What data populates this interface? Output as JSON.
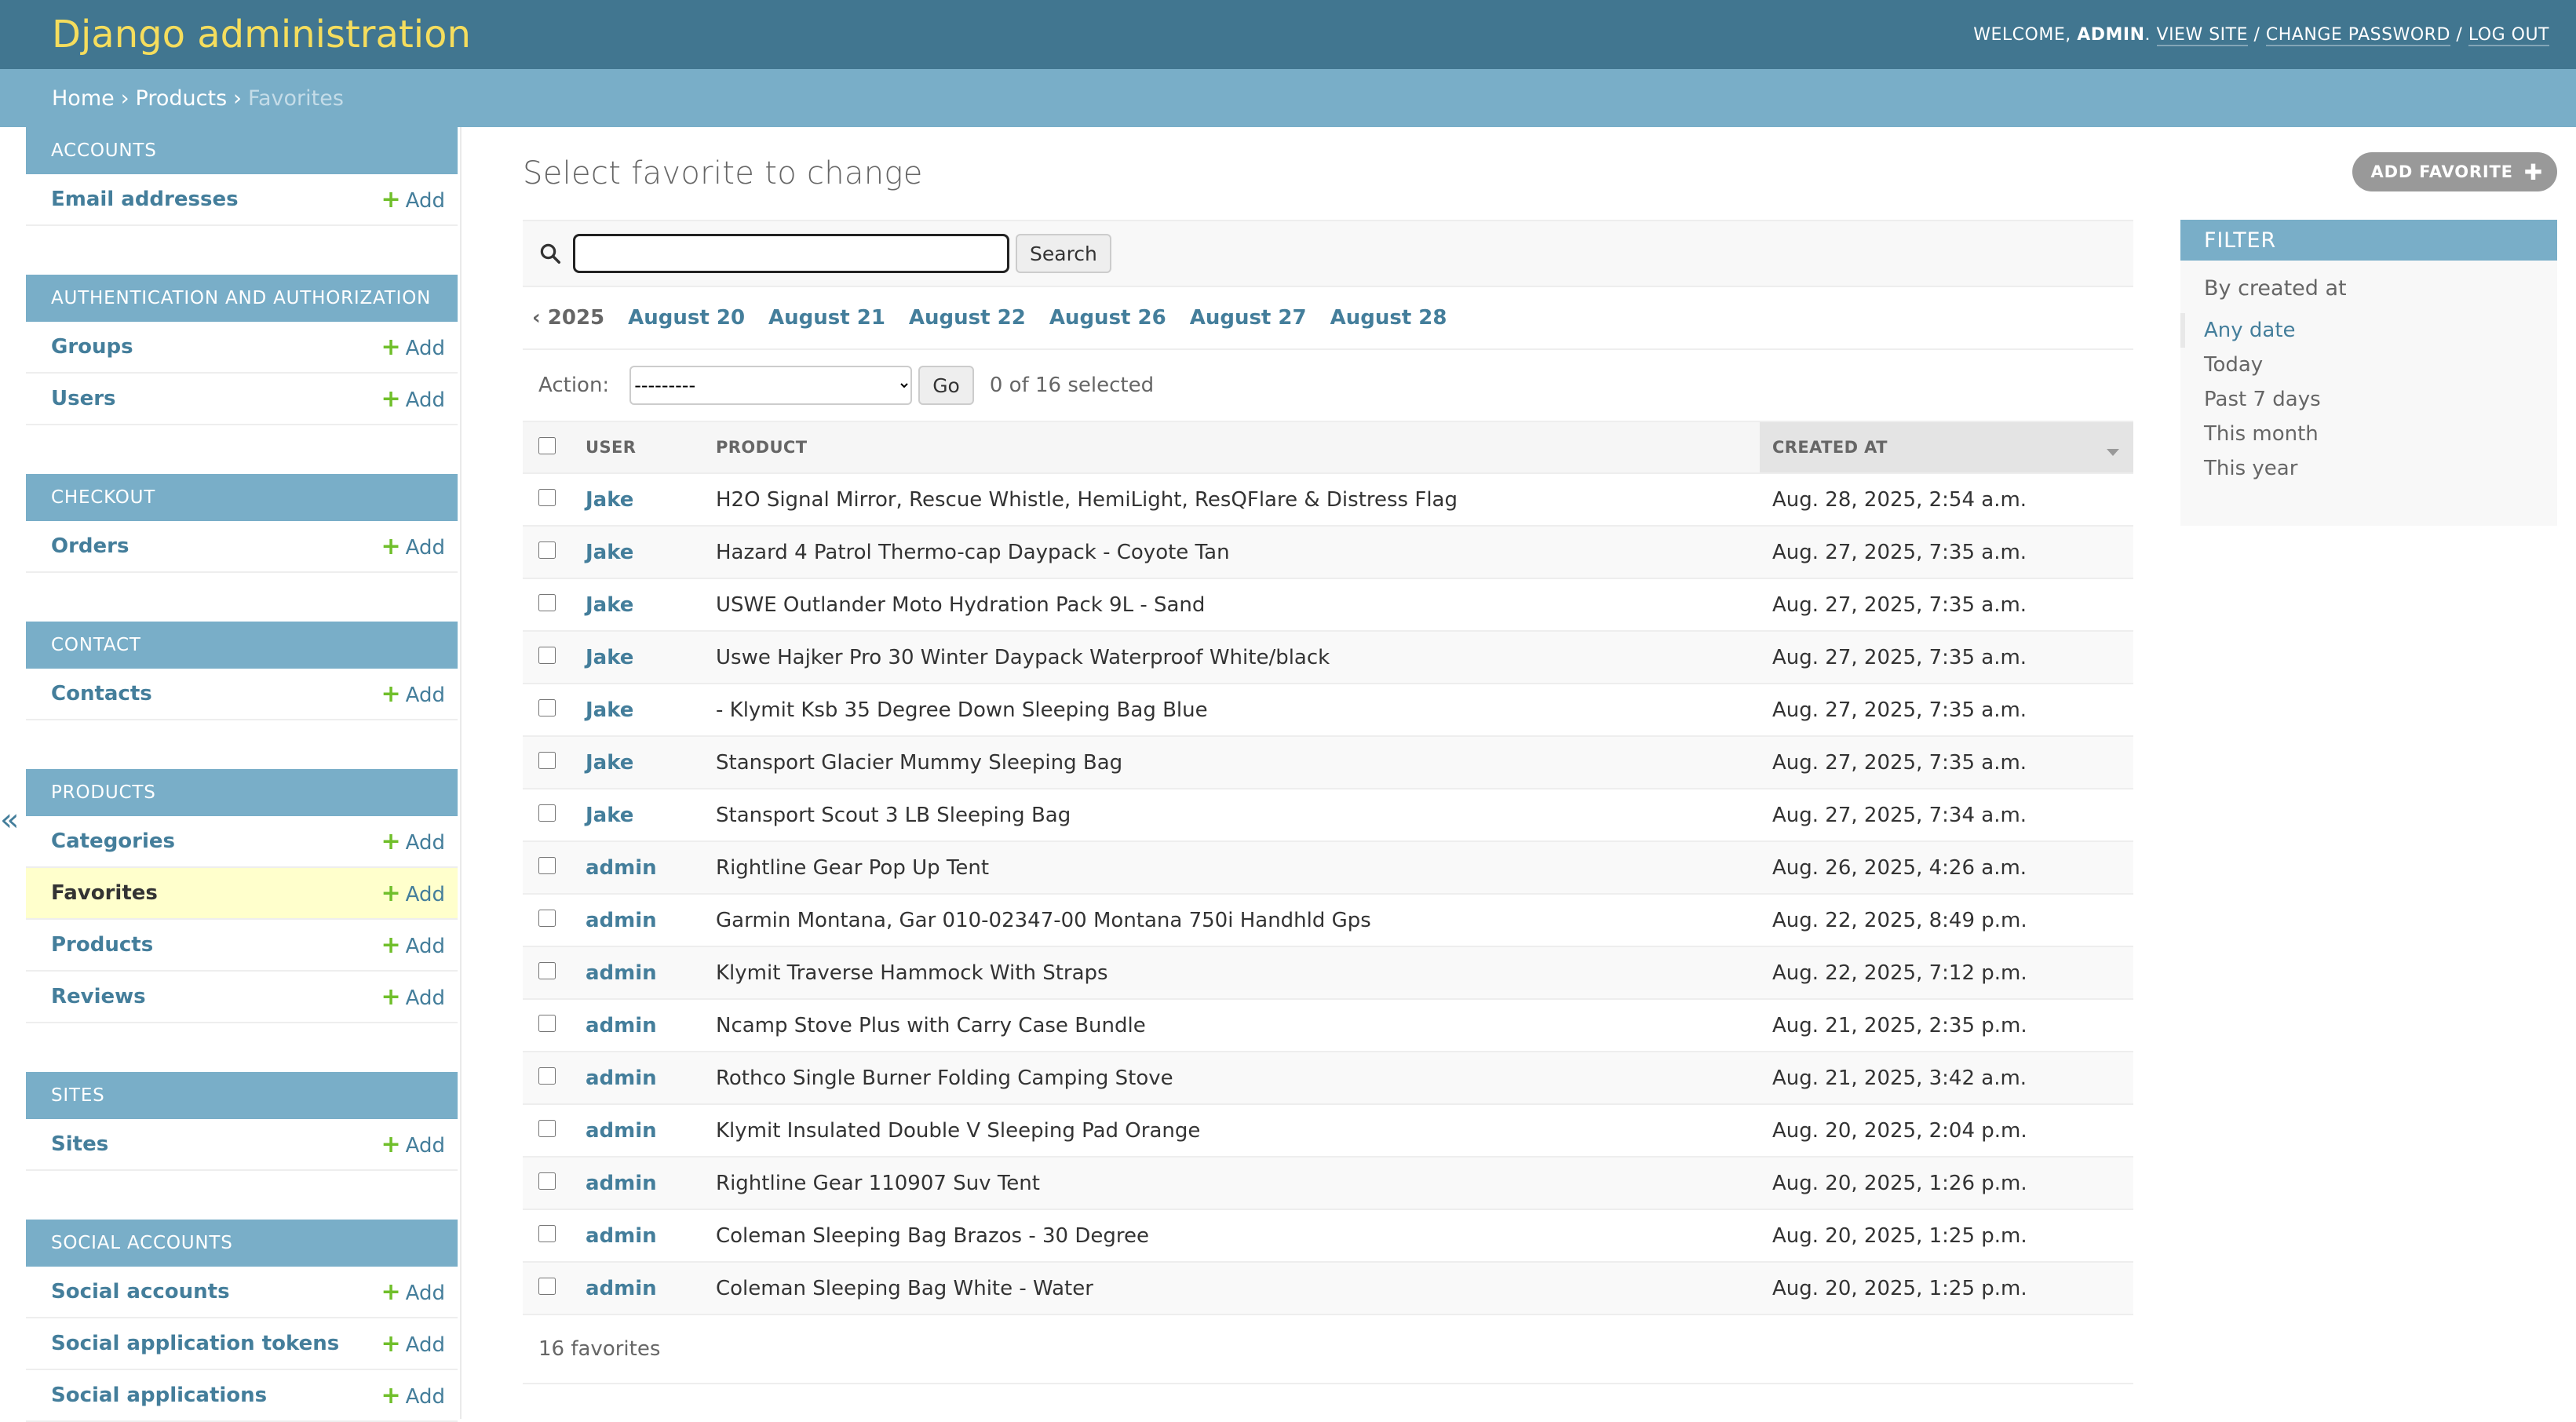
{
  "header": {
    "brand": "Django administration",
    "welcome": "Welcome,",
    "username": "admin",
    "view_site": "View site",
    "change_password": "Change password",
    "log_out": "Log out"
  },
  "breadcrumbs": {
    "home": "Home",
    "app": "Products",
    "current": "Favorites",
    "separator": "›"
  },
  "nav_toggle": "«",
  "sidebar": {
    "modules": [
      {
        "caption": "Accounts",
        "rows": [
          {
            "label": "Email addresses",
            "add": "Add",
            "current": false
          }
        ]
      },
      {
        "caption": "Authentication and Authorization",
        "rows": [
          {
            "label": "Groups",
            "add": "Add",
            "current": false
          },
          {
            "label": "Users",
            "add": "Add",
            "current": false
          }
        ]
      },
      {
        "caption": "Checkout",
        "rows": [
          {
            "label": "Orders",
            "add": "Add",
            "current": false
          }
        ]
      },
      {
        "caption": "Contact",
        "rows": [
          {
            "label": "Contacts",
            "add": "Add",
            "current": false
          }
        ]
      },
      {
        "caption": "Products",
        "rows": [
          {
            "label": "Categories",
            "add": "Add",
            "current": false
          },
          {
            "label": "Favorites",
            "add": "Add",
            "current": true
          },
          {
            "label": "Products",
            "add": "Add",
            "current": false
          },
          {
            "label": "Reviews",
            "add": "Add",
            "current": false
          }
        ]
      },
      {
        "caption": "Sites",
        "rows": [
          {
            "label": "Sites",
            "add": "Add",
            "current": false
          }
        ]
      },
      {
        "caption": "Social Accounts",
        "rows": [
          {
            "label": "Social accounts",
            "add": "Add",
            "current": false
          },
          {
            "label": "Social application tokens",
            "add": "Add",
            "current": false
          },
          {
            "label": "Social applications",
            "add": "Add",
            "current": false
          }
        ]
      }
    ]
  },
  "content": {
    "title": "Select favorite to change",
    "add_button": "Add favorite",
    "search": {
      "value": "",
      "button": "Search"
    },
    "date_hierarchy": {
      "back": "‹ 2025",
      "links": [
        "August 20",
        "August 21",
        "August 22",
        "August 26",
        "August 27",
        "August 28"
      ]
    },
    "actions": {
      "label": "Action:",
      "selected_option": "---------",
      "go": "Go",
      "counter": "0 of 16 selected"
    },
    "columns": {
      "user": "User",
      "product": "Product",
      "created": "Created at"
    },
    "rows": [
      {
        "user": "Jake",
        "product": "H2O Signal Mirror, Rescue Whistle, HemiLight, ResQFlare & Distress Flag",
        "created": "Aug. 28, 2025, 2:54 a.m."
      },
      {
        "user": "Jake",
        "product": "Hazard 4 Patrol Thermo-cap Daypack - Coyote Tan",
        "created": "Aug. 27, 2025, 7:35 a.m."
      },
      {
        "user": "Jake",
        "product": "USWE Outlander Moto Hydration Pack 9L - Sand",
        "created": "Aug. 27, 2025, 7:35 a.m."
      },
      {
        "user": "Jake",
        "product": "Uswe Hajker Pro 30 Winter Daypack Waterproof White/black",
        "created": "Aug. 27, 2025, 7:35 a.m."
      },
      {
        "user": "Jake",
        "product": "- Klymit Ksb 35 Degree Down Sleeping Bag Blue",
        "created": "Aug. 27, 2025, 7:35 a.m."
      },
      {
        "user": "Jake",
        "product": "Stansport Glacier Mummy Sleeping Bag",
        "created": "Aug. 27, 2025, 7:35 a.m."
      },
      {
        "user": "Jake",
        "product": "Stansport Scout 3 LB Sleeping Bag",
        "created": "Aug. 27, 2025, 7:34 a.m."
      },
      {
        "user": "admin",
        "product": "Rightline Gear Pop Up Tent",
        "created": "Aug. 26, 2025, 4:26 a.m."
      },
      {
        "user": "admin",
        "product": "Garmin Montana, Gar 010-02347-00 Montana 750i Handhld Gps",
        "created": "Aug. 22, 2025, 8:49 p.m."
      },
      {
        "user": "admin",
        "product": "Klymit Traverse Hammock With Straps",
        "created": "Aug. 22, 2025, 7:12 p.m."
      },
      {
        "user": "admin",
        "product": "Ncamp Stove Plus with Carry Case Bundle",
        "created": "Aug. 21, 2025, 2:35 p.m."
      },
      {
        "user": "admin",
        "product": "Rothco Single Burner Folding Camping Stove",
        "created": "Aug. 21, 2025, 3:42 a.m."
      },
      {
        "user": "admin",
        "product": "Klymit Insulated Double V Sleeping Pad Orange",
        "created": "Aug. 20, 2025, 2:04 p.m."
      },
      {
        "user": "admin",
        "product": "Rightline Gear 110907 Suv Tent",
        "created": "Aug. 20, 2025, 1:26 p.m."
      },
      {
        "user": "admin",
        "product": "Coleman Sleeping Bag Brazos - 30 Degree",
        "created": "Aug. 20, 2025, 1:25 p.m."
      },
      {
        "user": "admin",
        "product": "Coleman Sleeping Bag White - Water",
        "created": "Aug. 20, 2025, 1:25 p.m."
      }
    ],
    "paginator": "16 favorites"
  },
  "filter": {
    "title": "Filter",
    "heading": "By created at",
    "options": [
      "Any date",
      "Today",
      "Past 7 days",
      "This month",
      "This year"
    ],
    "selected": "Any date"
  },
  "colors": {
    "header": "#417690",
    "brand": "#f5dd5d",
    "caption": "#79aec8",
    "link": "#447e9b",
    "add_plus": "#70bf2b",
    "current_row": "#ffffcc"
  },
  "icons": {
    "search": "search-icon",
    "add": "plus-icon",
    "sort": "sort-descending-icon",
    "toggle": "collapse-sidebar-icon"
  }
}
